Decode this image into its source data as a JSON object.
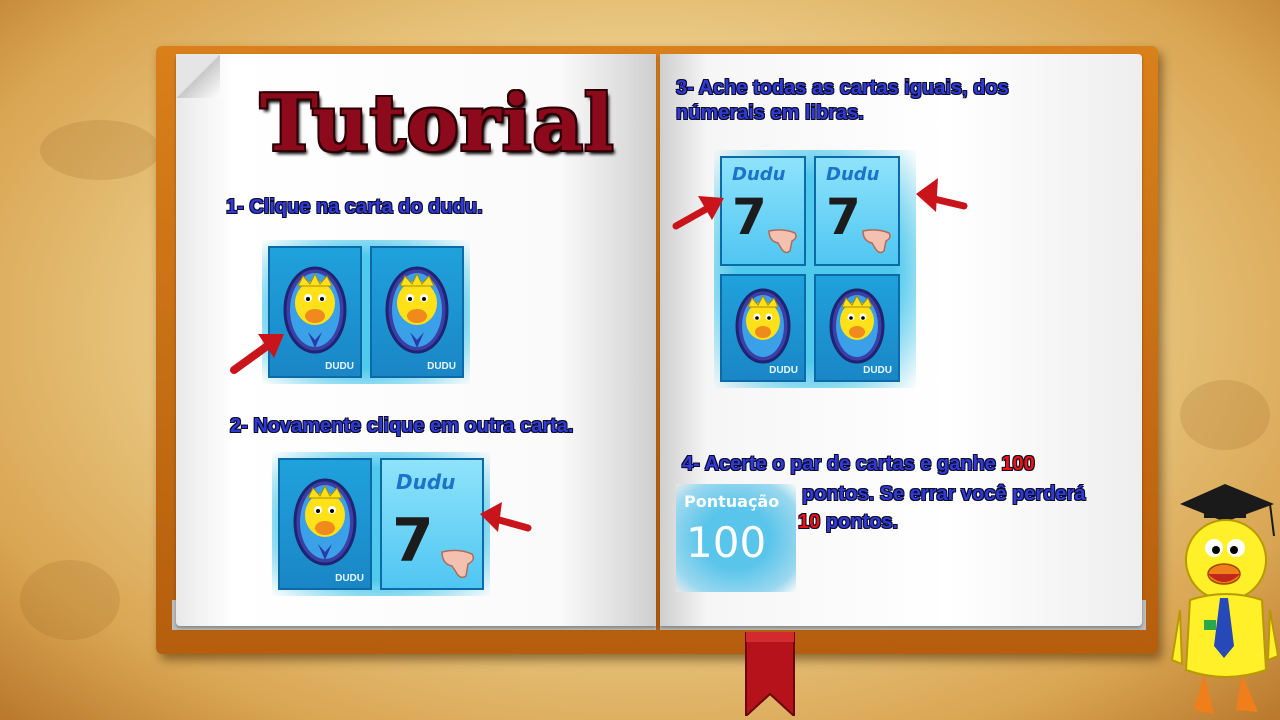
{
  "title": "Tutorial",
  "steps": {
    "step1": "1- Clique na carta do dudu.",
    "step2": "2- Novamente clique em outra carta.",
    "step3_line1": "3-  Ache todas as cartas iguais, dos",
    "step3_line2": "númerais em libras.",
    "step4_prefix": "4- Acerte o par de cartas e ganhe ",
    "step4_gain": "100",
    "step4_line2": "pontos. Se errar  você perderá",
    "step4_loss": "10",
    "step4_line3": " pontos."
  },
  "cards": {
    "duck_label": "DUDU",
    "brand_text": "Dudu",
    "number_sign": "7"
  },
  "score": {
    "label": "Pontuação",
    "value": "100"
  },
  "colors": {
    "title_red": "#8d0a1d",
    "step_blue": "#2f3ad8",
    "arrow_red": "#c9141b",
    "book_orange": "#d9801b"
  }
}
